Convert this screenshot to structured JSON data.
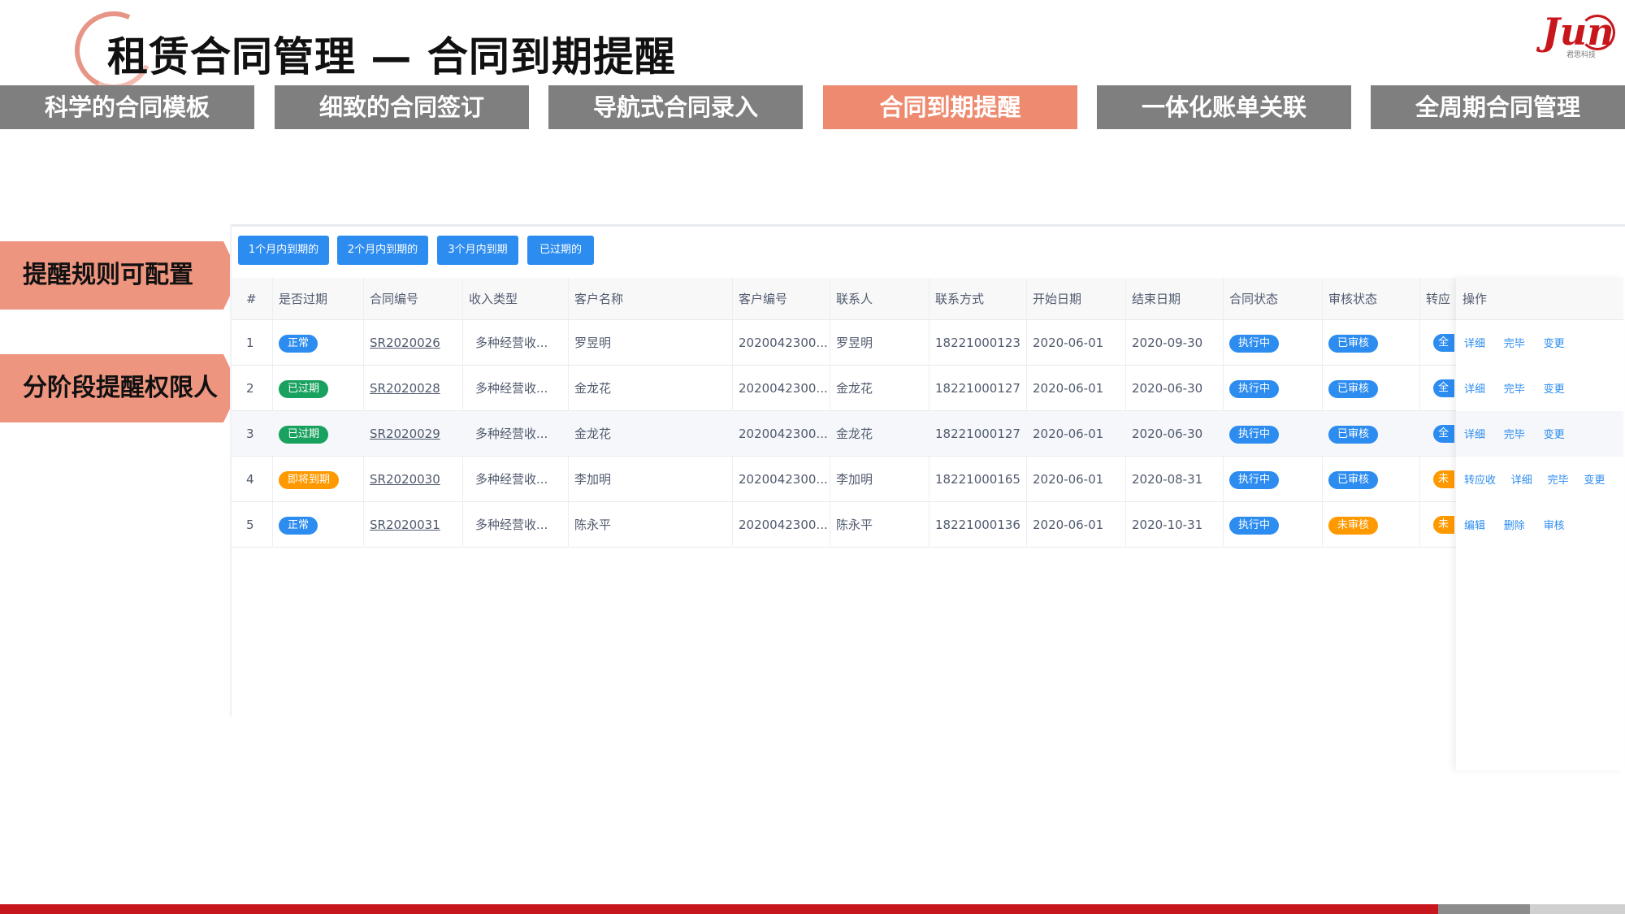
{
  "title": "租赁合同管理 — 合同到期提醒",
  "logo": {
    "mark": "Jun",
    "subtitle": "君思科技"
  },
  "tabs": [
    {
      "label": "科学的合同模板",
      "active": false
    },
    {
      "label": "细致的合同签订",
      "active": false
    },
    {
      "label": "导航式合同录入",
      "active": false
    },
    {
      "label": "合同到期提醒",
      "active": true
    },
    {
      "label": "一体化账单关联",
      "active": false
    },
    {
      "label": "全周期合同管理",
      "active": false
    }
  ],
  "callouts": [
    "提醒规则可配置",
    "分阶段提醒权限人"
  ],
  "filters": [
    "1个月内到期的",
    "2个月内到期的",
    "3个月内到期",
    "已过期的"
  ],
  "table": {
    "headers": [
      "#",
      "是否过期",
      "合同编号",
      "收入类型",
      "客户名称",
      "客户编号",
      "联系人",
      "联系方式",
      "开始日期",
      "结束日期",
      "合同状态",
      "审核状态",
      "转应",
      "操作"
    ],
    "rows": [
      {
        "no": "1",
        "expired": "正常",
        "expired_color": "blue",
        "code": "SR2020026",
        "income": "多种经营收...",
        "customer": "罗昱明",
        "customer_no": "2020042300...",
        "contact": "罗昱明",
        "phone": "18221000123",
        "start": "2020-06-01",
        "end": "2020-09-30",
        "status": "执行中",
        "audit": "已审核",
        "audit_color": "blue",
        "convert": "全",
        "convert_color": "blue",
        "ops": [
          "详细",
          "完毕",
          "变更"
        ]
      },
      {
        "no": "2",
        "expired": "已过期",
        "expired_color": "green",
        "code": "SR2020028",
        "income": "多种经营收...",
        "customer": "金龙花",
        "customer_no": "2020042300...",
        "contact": "金龙花",
        "phone": "18221000127",
        "start": "2020-06-01",
        "end": "2020-06-30",
        "status": "执行中",
        "audit": "已审核",
        "audit_color": "blue",
        "convert": "全",
        "convert_color": "blue",
        "ops": [
          "详细",
          "完毕",
          "变更"
        ]
      },
      {
        "no": "3",
        "expired": "已过期",
        "expired_color": "green",
        "code": "SR2020029",
        "income": "多种经营收...",
        "customer": "金龙花",
        "customer_no": "2020042300...",
        "contact": "金龙花",
        "phone": "18221000127",
        "start": "2020-06-01",
        "end": "2020-06-30",
        "status": "执行中",
        "audit": "已审核",
        "audit_color": "blue",
        "convert": "全",
        "convert_color": "blue",
        "ops": [
          "详细",
          "完毕",
          "变更"
        ]
      },
      {
        "no": "4",
        "expired": "即将到期",
        "expired_color": "orange",
        "code": "SR2020030",
        "income": "多种经营收...",
        "customer": "李加明",
        "customer_no": "2020042300...",
        "contact": "李加明",
        "phone": "18221000165",
        "start": "2020-06-01",
        "end": "2020-08-31",
        "status": "执行中",
        "audit": "已审核",
        "audit_color": "blue",
        "convert": "未",
        "convert_color": "orange",
        "ops": [
          "转应收",
          "详细",
          "完毕",
          "变更"
        ]
      },
      {
        "no": "5",
        "expired": "正常",
        "expired_color": "blue",
        "code": "SR2020031",
        "income": "多种经营收...",
        "customer": "陈永平",
        "customer_no": "2020042300...",
        "contact": "陈永平",
        "phone": "18221000136",
        "start": "2020-06-01",
        "end": "2020-10-31",
        "status": "执行中",
        "audit": "未审核",
        "audit_color": "orange",
        "convert": "未",
        "convert_color": "orange",
        "ops": [
          "编辑",
          "删除",
          "审核"
        ]
      }
    ]
  },
  "colors": {
    "accent_tab": "#ee8a6f",
    "tab_gray": "#7f7f7f",
    "primary_blue": "#2d8cf0",
    "green": "#19a15f",
    "orange": "#ff9900",
    "brand_red": "#c8161d"
  }
}
